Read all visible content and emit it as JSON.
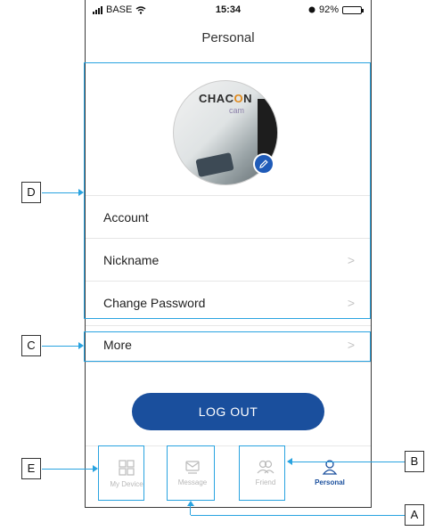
{
  "status_bar": {
    "carrier": "BASE",
    "time": "15:34",
    "battery": "92%",
    "battery_level": 0.92
  },
  "header": {
    "title": "Personal"
  },
  "avatar": {
    "logo_text_a": "CHAC",
    "logo_text_o": "O",
    "logo_text_b": "N",
    "logo_sub": "cam"
  },
  "menu": {
    "account": "Account",
    "nickname": "Nickname",
    "change_password": "Change Password",
    "more": "More",
    "chevron": ">"
  },
  "logout_label": "LOG OUT",
  "tabs": [
    {
      "label": "My Device",
      "icon": "grid-icon"
    },
    {
      "label": "Message",
      "icon": "message-icon"
    },
    {
      "label": "Friend",
      "icon": "friends-icon"
    },
    {
      "label": "Personal",
      "icon": "person-icon"
    }
  ],
  "annotations": {
    "a": "A",
    "b": "B",
    "c": "C",
    "d": "D",
    "e": "E"
  },
  "colors": {
    "accent": "#1a4f9d",
    "annotation": "#29a3e0"
  }
}
